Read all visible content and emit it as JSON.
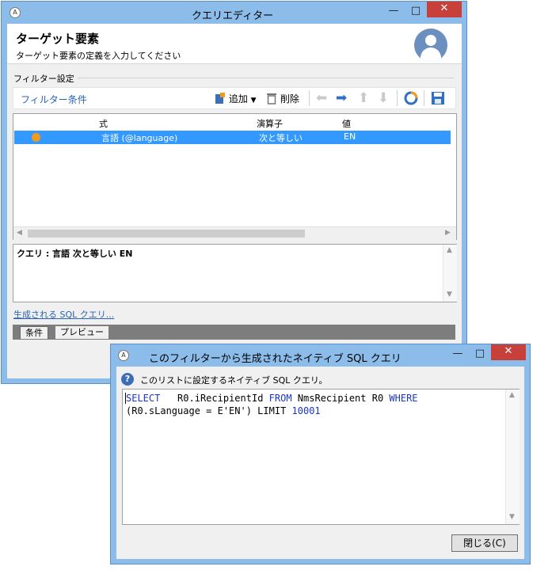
{
  "main_window": {
    "title": "クエリエディター",
    "header": {
      "title": "ターゲット要素",
      "subtitle": "ターゲット要素の定義を入力してください"
    },
    "filter_group_label": "フィルター設定",
    "toolbar": {
      "filter_conditions_label": "フィルター条件",
      "add_label": "追加",
      "delete_label": "削除"
    },
    "list": {
      "columns": [
        "式",
        "演算子",
        "値"
      ],
      "rows": [
        {
          "expression": "言語 (@language)",
          "operator": "次と等しい",
          "value": "EN"
        }
      ]
    },
    "query_text": "クエリ : 言語 次と等しい EN",
    "sql_link": "生成される SQL クエリ...",
    "tabs": [
      "条件",
      "プレビュー"
    ]
  },
  "dialog": {
    "title": "このフィルターから生成されたネイティブ SQL クエリ",
    "help_text": "このリストに設定するネイティブ SQL クエリ。",
    "sql": {
      "line1_kw1": "SELECT",
      "line1_a": "R0.iRecipientId",
      "line1_kw2": "FROM",
      "line1_b": "NmsRecipient R0",
      "line1_kw3": "WHERE",
      "line2_a": "(R0.sLanguage = E'EN') LIMIT",
      "line2_num": "10001"
    },
    "close_button": "閉じる(C)"
  },
  "icons": {
    "app": "app-icon",
    "avatar": "user-avatar-icon",
    "add": "add-filter-icon",
    "delete": "trash-icon"
  },
  "colors": {
    "selection": "#3399ff",
    "title_bar": "#8cbcea",
    "close_button": "#c7403a",
    "link": "#2a63b8",
    "sql_keyword": "#1c36c8",
    "status_orange": "#f19a1e"
  }
}
